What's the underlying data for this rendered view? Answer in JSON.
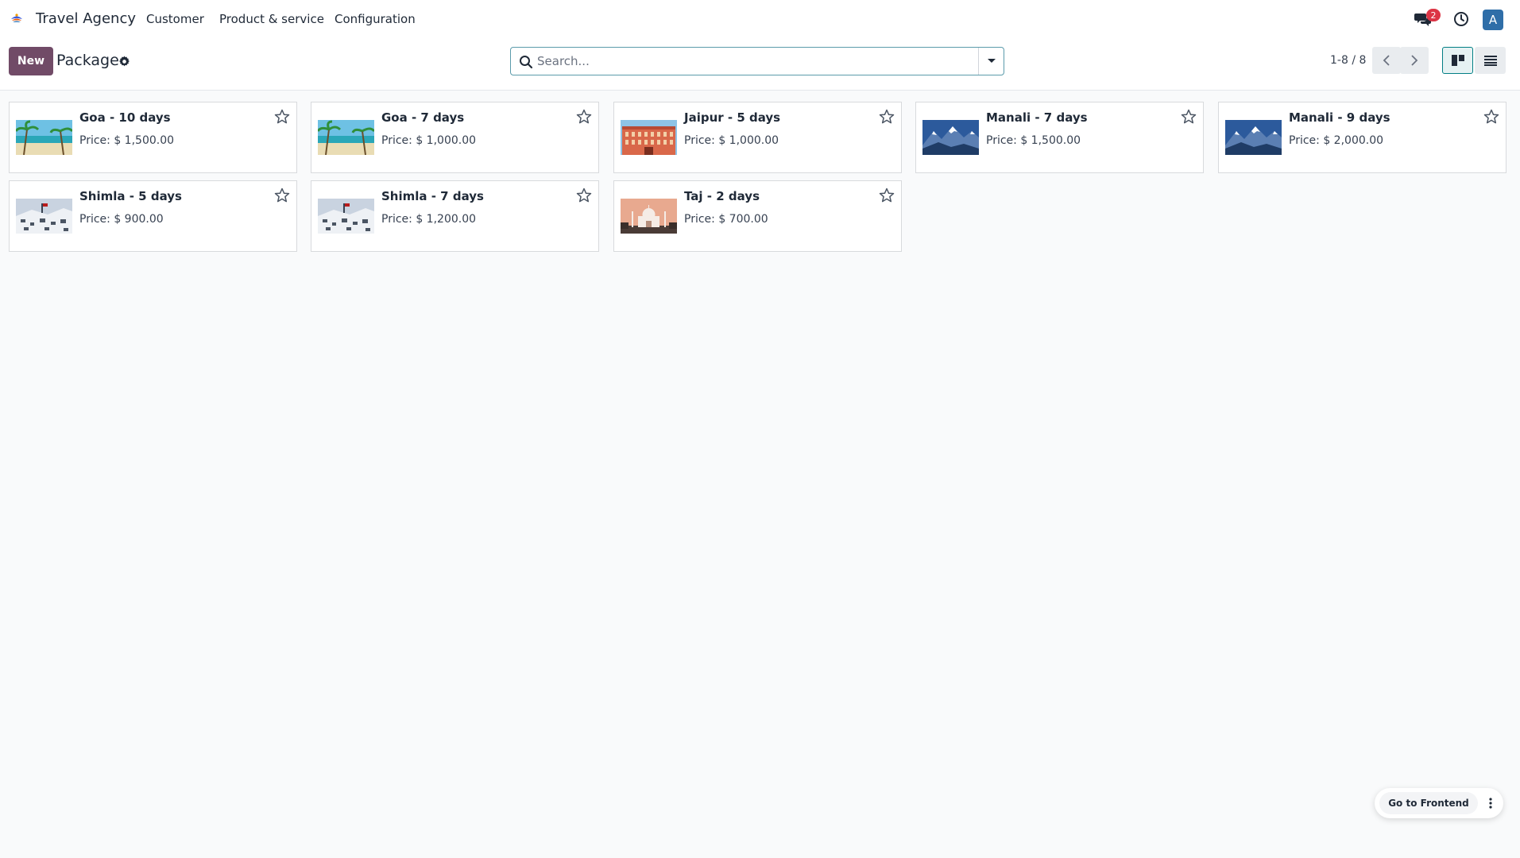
{
  "navbar": {
    "app_name": "Travel Agency",
    "menus": [
      "Customer",
      "Product & service",
      "Configuration"
    ],
    "messages_count": "2",
    "avatar_initial": "A"
  },
  "control_panel": {
    "new_label": "New",
    "title": "Package",
    "search_placeholder": "Search...",
    "pager": "1-8 / 8"
  },
  "cards": [
    {
      "name": "Goa - 10 days",
      "price": "Price: $ 1,500.00",
      "image": "beach"
    },
    {
      "name": "Goa - 7 days",
      "price": "Price: $ 1,000.00",
      "image": "beach"
    },
    {
      "name": "Jaipur - 5 days",
      "price": "Price: $ 1,000.00",
      "image": "palace"
    },
    {
      "name": "Manali - 7 days",
      "price": "Price: $ 1,500.00",
      "image": "mountains"
    },
    {
      "name": "Manali - 9 days",
      "price": "Price: $ 2,000.00",
      "image": "mountains"
    },
    {
      "name": "Shimla - 5 days",
      "price": "Price: $ 900.00",
      "image": "snow-town"
    },
    {
      "name": "Shimla - 7 days",
      "price": "Price: $ 1,200.00",
      "image": "snow-town"
    },
    {
      "name": "Taj - 2 days",
      "price": "Price: $ 700.00",
      "image": "taj-mahal"
    }
  ],
  "floating": {
    "frontend_label": "Go to Frontend"
  },
  "colors": {
    "brand": "#714b67",
    "accent": "#017e84",
    "badge": "#dc3545",
    "avatar": "#2f6ea8"
  }
}
